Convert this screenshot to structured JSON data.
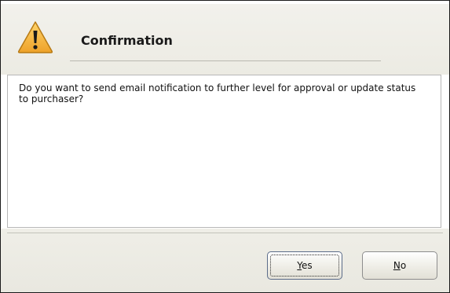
{
  "dialog": {
    "title": "Confirmation",
    "icon": "warning-icon",
    "message": "Do you want to send email notification to further level for approval or update status to purchaser?"
  },
  "buttons": {
    "yes": {
      "mnemonic": "Y",
      "rest": "es"
    },
    "no": {
      "mnemonic": "N",
      "rest": "o"
    }
  },
  "colors": {
    "warning_fill": "#f4b23a",
    "warning_border": "#b77a14",
    "header_bg": "#efeee6",
    "footer_bg": "#ecebe3"
  }
}
